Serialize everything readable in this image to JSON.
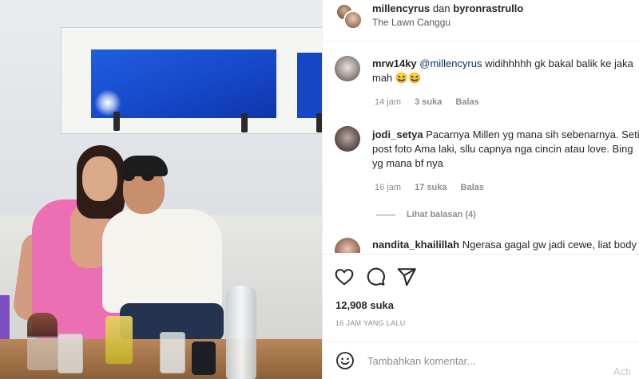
{
  "post": {
    "image_alt": "Photo of a couple at a restaurant table",
    "author1": "millencyrus",
    "conjunction": "dan",
    "author2": "byronrastrullo",
    "location": "The Lawn Canggu"
  },
  "comments": [
    {
      "user": "mrw14ky",
      "mention": "@millencyrus",
      "text_line1": "widihhhhh gk bakal balik ke jaka",
      "text_line2": "mah 😆😆",
      "age": "14 jam",
      "likes": "3 suka",
      "reply_label": "Balas"
    },
    {
      "user": "jodi_setya",
      "text_line1": "Pacarnya Millen yg mana sih sebenarnya. Seti",
      "text_line2": "post foto Ama laki, sllu capnya nga cincin atau love. Bing",
      "text_line3": "yg mana bf nya",
      "age": "16 jam",
      "likes": "17 suka",
      "reply_label": "Balas",
      "view_replies": "Lihat balasan (4)"
    },
    {
      "user": "nandita_khailillah",
      "text_line1": "Ngerasa gagal gw jadi cewe, liat body"
    }
  ],
  "actions": {
    "like_icon": "heart-icon",
    "comment_icon": "comment-icon",
    "share_icon": "share-icon",
    "likes_count": "12,908 suka",
    "posted_time": "16 JAM YANG LALU"
  },
  "add_comment": {
    "emoji_icon": "emoji-icon",
    "placeholder": "Tambahkan komentar..."
  },
  "watermark": "Acti"
}
